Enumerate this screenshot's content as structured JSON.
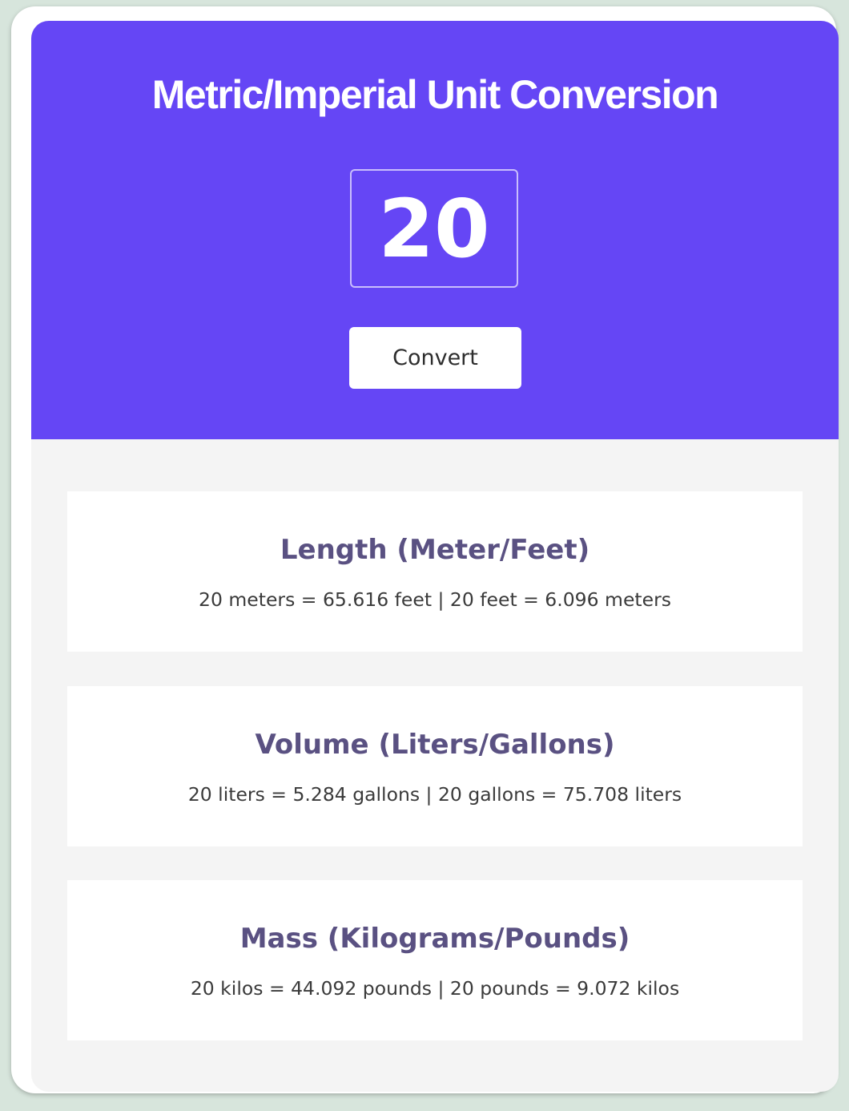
{
  "header": {
    "title": "Metric/Imperial Unit Conversion",
    "input_value": "20",
    "convert_label": "Convert"
  },
  "results": [
    {
      "title": "Length (Meter/Feet)",
      "text": "20 meters = 65.616 feet | 20 feet = 6.096 meters"
    },
    {
      "title": "Volume (Liters/Gallons)",
      "text": "20 liters = 5.284 gallons | 20 gallons = 75.708 liters"
    },
    {
      "title": "Mass (Kilograms/Pounds)",
      "text": "20 kilos = 44.092 pounds | 20 pounds = 9.072 kilos"
    }
  ],
  "colors": {
    "header_background": "#6546f5",
    "result_title": "#5a5182",
    "body_background": "#f4f4f4"
  }
}
